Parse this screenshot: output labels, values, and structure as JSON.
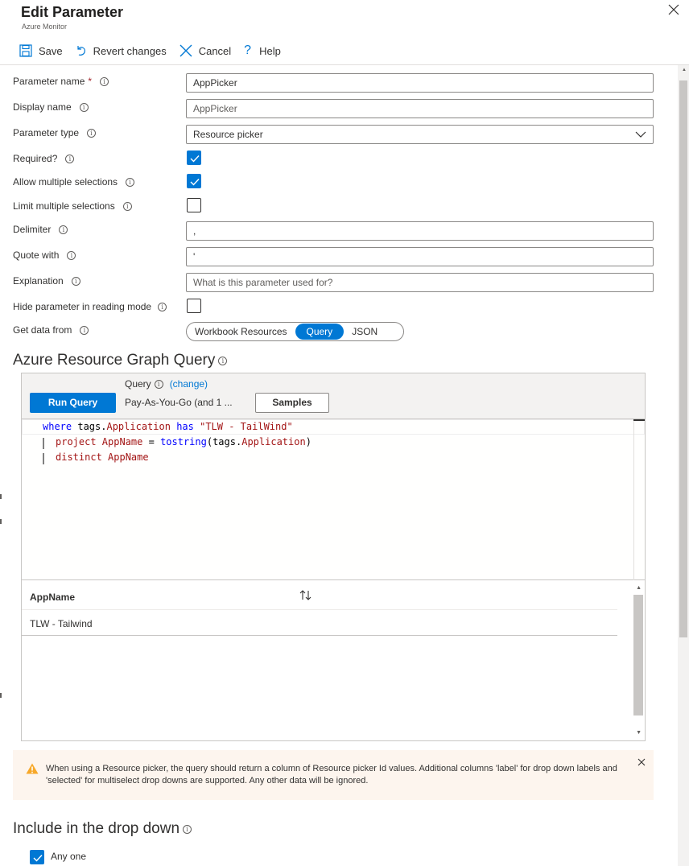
{
  "header": {
    "title": "Edit Parameter",
    "subtitle": "Azure Monitor"
  },
  "toolbar": {
    "save": "Save",
    "revert": "Revert changes",
    "cancel": "Cancel",
    "help": "Help"
  },
  "form": {
    "parameter_name": {
      "label": "Parameter name",
      "required_mark": "*",
      "value": "AppPicker"
    },
    "display_name": {
      "label": "Display name",
      "value": "AppPicker"
    },
    "parameter_type": {
      "label": "Parameter type",
      "value": "Resource picker"
    },
    "required": {
      "label": "Required?",
      "checked": true
    },
    "allow_multiple": {
      "label": "Allow multiple selections",
      "checked": true
    },
    "limit_multiple": {
      "label": "Limit multiple selections",
      "checked": false
    },
    "delimiter": {
      "label": "Delimiter",
      "value": ","
    },
    "quote_with": {
      "label": "Quote with",
      "value": "'"
    },
    "explanation": {
      "label": "Explanation",
      "placeholder": "What is this parameter used for?"
    },
    "hide_param": {
      "label": "Hide parameter in reading mode",
      "checked": false
    },
    "get_data_from": {
      "label": "Get data from",
      "options": [
        "Workbook Resources",
        "Query",
        "JSON"
      ],
      "selected": "Query"
    }
  },
  "query_section": {
    "heading": "Azure Resource Graph Query",
    "run_button": "Run Query",
    "query_label": "Query",
    "change_link": "(change)",
    "subscription": "Pay-As-You-Go (and 1 ...",
    "samples_button": "Samples",
    "code": {
      "line1": {
        "kw": "where",
        "id": " tags.",
        "fn": "Application",
        "kw2": " has ",
        "str": "\"TLW - TailWind\""
      },
      "line2": {
        "kw": "project",
        "fn": " AppName",
        "op": " = ",
        "kw2": "tostring",
        "id": "(tags.",
        "fn2": "Application",
        "end": ")"
      },
      "line3": {
        "kw": "distinct",
        "fn": " AppName"
      }
    },
    "results": {
      "column": "AppName",
      "rows": [
        "TLW - Tailwind"
      ]
    }
  },
  "warning": {
    "text": "When using a Resource picker, the query should return a column of Resource picker Id values. Additional columns 'label' for drop down labels and 'selected' for multiselect drop downs are supported. Any other data will be ignored."
  },
  "include_section": {
    "heading": "Include in the drop down",
    "any_one": {
      "label": "Any one",
      "checked": true
    }
  },
  "colors": {
    "accent": "#0078d4",
    "warning_bg": "#fdf5ee",
    "warning_icon": "#f7a82a"
  }
}
